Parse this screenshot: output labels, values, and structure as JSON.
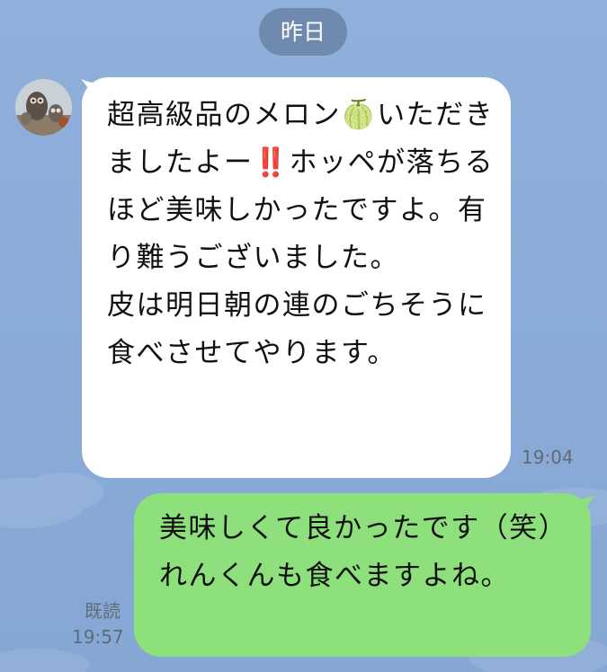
{
  "chat": {
    "date_separator": "昨日",
    "messages": [
      {
        "direction": "incoming",
        "text": "超高級品のメロン🍈いただきましたよー‼️ホッペが落ちるほど美味しかったですよ。有り難うございました。\n皮は明日朝の連のごちそうに食べさせてやります。",
        "time": "19:04",
        "avatar_icon": "owl-figurines-avatar"
      },
      {
        "direction": "outgoing",
        "text": "美味しくて良かったです（笑）\nれんくんも食べますよね。",
        "status": "既読",
        "time": "19:57"
      }
    ]
  },
  "colors": {
    "background": "#8aabd7",
    "incoming_bubble": "#ffffff",
    "outgoing_bubble": "#8ee07c",
    "date_pill": "#647c9e",
    "meta_text": "#5f6b78"
  }
}
